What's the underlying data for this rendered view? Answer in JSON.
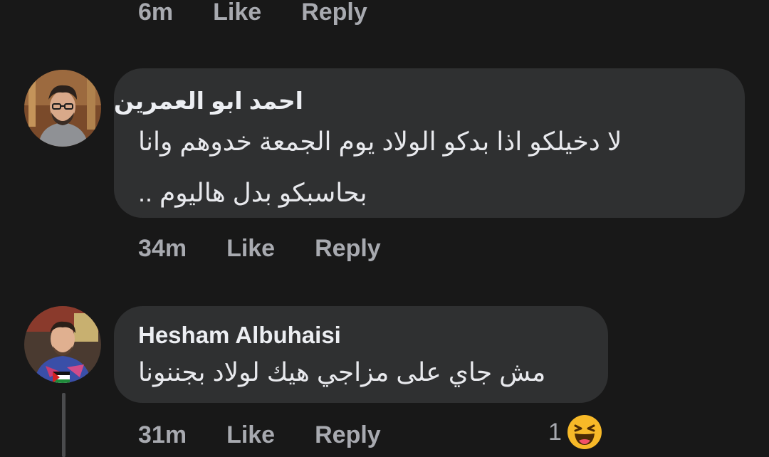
{
  "comments": [
    {
      "time": "6m",
      "like_label": "Like",
      "reply_label": "Reply"
    },
    {
      "author": "احمد ابو العمرين",
      "text_line1": "لا دخيلكو اذا بدكو الولاد يوم الجمعة خدوهم وانا",
      "text_line2": "بحاسبكو بدل هاليوم ..",
      "time": "34m",
      "like_label": "Like",
      "reply_label": "Reply"
    },
    {
      "author": "Hesham Albuhaisi",
      "text_line1": "مش جاي على مزاجي هيك لولاد بجننونا",
      "time": "31m",
      "like_label": "Like",
      "reply_label": "Reply",
      "reaction": {
        "count": "1",
        "icon": "haha-reaction-icon",
        "color": "#f7b928"
      }
    }
  ],
  "colors": {
    "background": "#181818",
    "bubble": "#2f3031",
    "meta_text": "#a8aab0"
  }
}
